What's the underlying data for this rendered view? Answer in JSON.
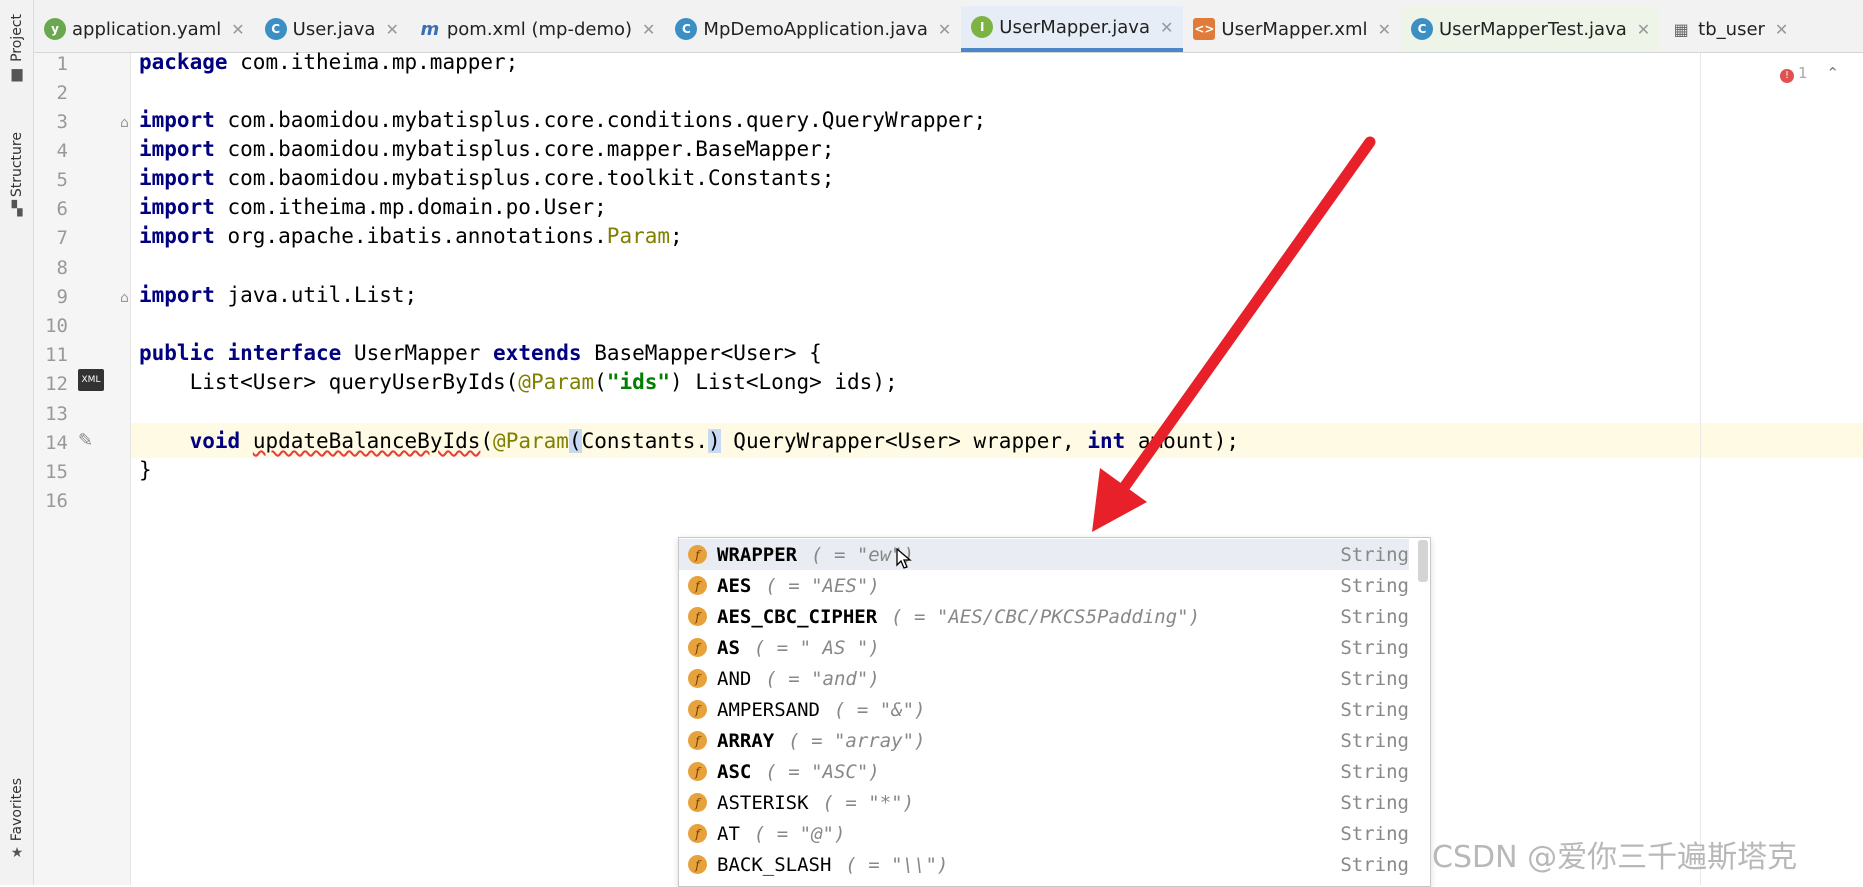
{
  "sidebar": {
    "project_label": "Project",
    "structure_label": "Structure",
    "favorites_label": "Favorites"
  },
  "tabs": [
    {
      "label": "application.yaml",
      "icon": "yaml-icon"
    },
    {
      "label": "User.java",
      "icon": "class-icon"
    },
    {
      "label": "pom.xml (mp-demo)",
      "icon": "maven-icon"
    },
    {
      "label": "MpDemoApplication.java",
      "icon": "spring-class-icon"
    },
    {
      "label": "UserMapper.java",
      "icon": "interface-icon",
      "active": true
    },
    {
      "label": "UserMapper.xml",
      "icon": "xml-icon"
    },
    {
      "label": "UserMapperTest.java",
      "icon": "test-class-icon"
    },
    {
      "label": "tb_user",
      "icon": "table-icon"
    }
  ],
  "editor": {
    "line_numbers": [
      "1",
      "2",
      "3",
      "4",
      "5",
      "6",
      "7",
      "8",
      "9",
      "10",
      "11",
      "12",
      "13",
      "14",
      "15",
      "16"
    ],
    "inspection_count": "1",
    "lines": {
      "l1_kw": "package",
      "l1_rest": " com.itheima.mp.mapper;",
      "l3_kw": "import",
      "l3_rest": " com.baomidou.mybatisplus.core.conditions.query.QueryWrapper;",
      "l4_kw": "import",
      "l4_rest": " com.baomidou.mybatisplus.core.mapper.BaseMapper;",
      "l5_kw": "import",
      "l5_rest": " com.baomidou.mybatisplus.core.toolkit.Constants;",
      "l6_kw": "import",
      "l6_rest": " com.itheima.mp.domain.po.User;",
      "l7_kw": "import",
      "l7_rest": " org.apache.ibatis.annotations.",
      "l7_ann": "Param",
      "l7_end": ";",
      "l9_kw": "import",
      "l9_rest": " java.util.List;",
      "l11_kw1": "public",
      "l11_kw2": "interface",
      "l11_a": " UserMapper ",
      "l11_kw3": "extends",
      "l11_b": " BaseMapper<User> {",
      "l12_a": "    List<User> queryUserByIds(",
      "l12_ann": "@Param",
      "l12_b": "(",
      "l12_str": "\"ids\"",
      "l12_c": ") List<Long> ids);",
      "l14_kw": "    void",
      "l14_sp": " ",
      "l14_method": "updateBalanceByIds",
      "l14_a": "(",
      "l14_ann": "@Param",
      "l14_b": "(",
      "l14_c": "Constants.",
      "l14_d": ")",
      "l14_e": " QueryWrapper<User> wrapper, ",
      "l14_kw2": "int",
      "l14_f": " amount);",
      "l15": "}"
    }
  },
  "completion": {
    "items": [
      {
        "name": "WRAPPER",
        "bold": true,
        "value": "( = \"ew\")",
        "type": "String"
      },
      {
        "name": "AES",
        "bold": true,
        "value": "( = \"AES\")",
        "type": "String"
      },
      {
        "name": "AES_CBC_CIPHER",
        "bold": true,
        "value": "( = \"AES/CBC/PKCS5Padding\")",
        "type": "String"
      },
      {
        "name": "AS",
        "bold": true,
        "value": "( = \" AS \")",
        "type": "String"
      },
      {
        "name": "AND",
        "bold": false,
        "value": "( = \"and\")",
        "type": "String"
      },
      {
        "name": "AMPERSAND",
        "bold": false,
        "value": "( = \"&\")",
        "type": "String"
      },
      {
        "name": "ARRAY",
        "bold": true,
        "value": "( = \"array\")",
        "type": "String"
      },
      {
        "name": "ASC",
        "bold": true,
        "value": "( = \"ASC\")",
        "type": "String"
      },
      {
        "name": "ASTERISK",
        "bold": false,
        "value": "( = \"*\")",
        "type": "String"
      },
      {
        "name": "AT",
        "bold": false,
        "value": "( = \"@\")",
        "type": "String"
      },
      {
        "name": "BACK_SLASH",
        "bold": false,
        "value": "( = \"\\\\\")",
        "type": "String"
      }
    ]
  },
  "watermark": "CSDN @爱你三千遍斯塔克",
  "colors": {
    "arrow": "#e8202a",
    "active_tab_underline": "#4a86c8",
    "keyword": "#000080",
    "annotation": "#808000"
  }
}
